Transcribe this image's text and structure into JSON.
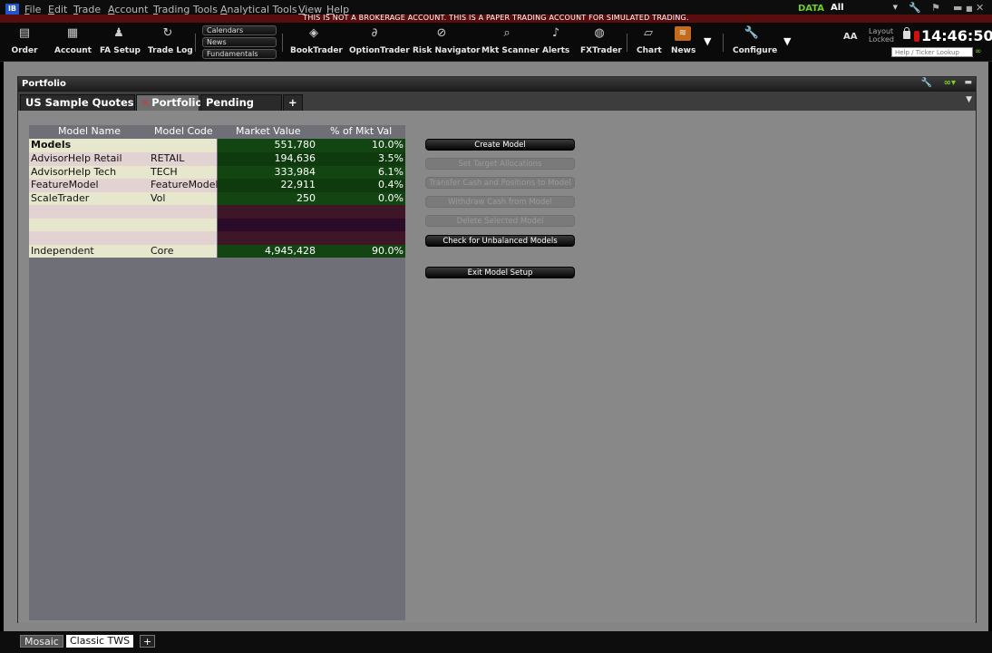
{
  "menu": {
    "logo": "IB",
    "items": [
      "File",
      "Edit",
      "Trade",
      "Account",
      "Trading Tools",
      "Analytical Tools",
      "View",
      "Help"
    ],
    "banner": "THIS IS NOT A BROKERAGE ACCOUNT. THIS IS A PAPER TRADING ACCOUNT FOR SIMULATED TRADING.",
    "data_label": "DATA",
    "data_value": "All"
  },
  "toolbar": {
    "order": "Order",
    "account": "Account",
    "fa_setup": "FA Setup",
    "trade_log": "Trade Log",
    "calendars": "Calendars",
    "news_btn": "News",
    "fundamentals": "Fundamentals",
    "booktrader": "BookTrader",
    "optiontrader": "OptionTrader",
    "risk_navigator": "Risk Navigator",
    "mkt_scanner": "Mkt Scanner",
    "alerts": "Alerts",
    "fxtrader": "FXTrader",
    "chart": "Chart",
    "news": "News",
    "configure": "Configure",
    "font_size": "AA",
    "layout_line1": "Layout",
    "layout_line2": "Locked",
    "clock": "14:46:50",
    "ticker_placeholder": "Help / Ticker Lookup"
  },
  "window": {
    "title": "Portfolio",
    "tabs": [
      "US Sample Quotes",
      "Portfolio",
      "Pending (All)",
      "+"
    ]
  },
  "table": {
    "headers": [
      "Model Name",
      "Model Code",
      "Market Value",
      "% of Mkt Val"
    ],
    "rows": [
      {
        "name": "Models",
        "code": "",
        "mv": "551,780",
        "pct": "10.0%",
        "bold": true
      },
      {
        "name": "AdvisorHelp Retail",
        "code": "RETAIL",
        "mv": "194,636",
        "pct": "3.5%"
      },
      {
        "name": "AdvisorHelp Tech",
        "code": "TECH",
        "mv": "333,984",
        "pct": "6.1%"
      },
      {
        "name": "FeatureModel",
        "code": "FeatureModel",
        "mv": "22,911",
        "pct": "0.4%"
      },
      {
        "name": "ScaleTrader",
        "code": "Vol",
        "mv": "250",
        "pct": "0.0%"
      },
      {
        "name": "",
        "code": "",
        "mv": "",
        "pct": ""
      },
      {
        "name": "",
        "code": "",
        "mv": "",
        "pct": ""
      },
      {
        "name": "",
        "code": "",
        "mv": "",
        "pct": ""
      },
      {
        "name": "Independent",
        "code": "Core",
        "mv": "4,945,428",
        "pct": "90.0%"
      }
    ]
  },
  "buttons": {
    "create_model": "Create Model",
    "set_target": "Set Target Allocations",
    "transfer_cash": "Transfer Cash and Positions to Model",
    "withdraw_cash": "Withdraw Cash from Model",
    "delete_model": "Delete Selected Model",
    "check_unbalanced": "Check for Unbalanced Models",
    "exit_setup": "Exit Model Setup"
  },
  "bottom": {
    "tabs": [
      "Mosaic",
      "Classic TWS",
      "+"
    ]
  },
  "colors": {
    "accent_green": "#6ed026",
    "banner_red": "#5a0d0d",
    "mv_green": "#0e3d0e"
  }
}
